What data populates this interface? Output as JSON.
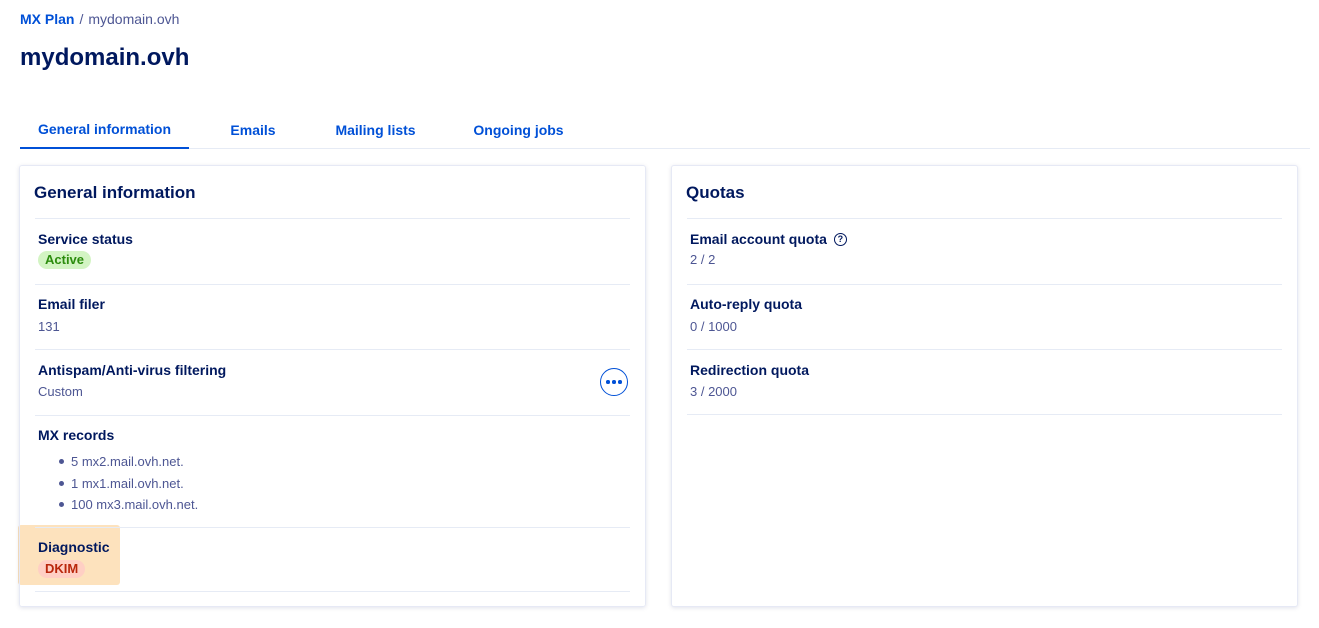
{
  "breadcrumb": {
    "parent": "MX Plan",
    "separator": "/",
    "current": "mydomain.ovh"
  },
  "page_title": "mydomain.ovh",
  "tabs": [
    {
      "label": "General information",
      "active": true
    },
    {
      "label": "Emails",
      "active": false
    },
    {
      "label": "Mailing lists",
      "active": false
    },
    {
      "label": "Ongoing jobs",
      "active": false
    }
  ],
  "general_info": {
    "title": "General information",
    "service_status": {
      "label": "Service status",
      "badge": "Active"
    },
    "email_filer": {
      "label": "Email filer",
      "value": "131"
    },
    "antispam": {
      "label": "Antispam/Anti-virus filtering",
      "value": "Custom",
      "action_icon": "ellipsis-icon"
    },
    "mx_records": {
      "label": "MX records",
      "items": [
        "5 mx2.mail.ovh.net.",
        "1 mx1.mail.ovh.net.",
        "100 mx3.mail.ovh.net."
      ]
    },
    "diagnostic": {
      "label": "Diagnostic",
      "badge": "DKIM"
    }
  },
  "quotas": {
    "title": "Quotas",
    "email_account": {
      "label": "Email account quota",
      "value": "2 / 2",
      "icon": "help-icon"
    },
    "auto_reply": {
      "label": "Auto-reply quota",
      "value": "0 / 1000"
    },
    "redirection": {
      "label": "Redirection quota",
      "value": "3 / 2000"
    }
  },
  "colors": {
    "primary": "#0050d7",
    "heading": "#00185e",
    "success_bg": "#d3f4c3",
    "error_bg": "#ffcfc4",
    "highlight": "#fde2bd"
  }
}
